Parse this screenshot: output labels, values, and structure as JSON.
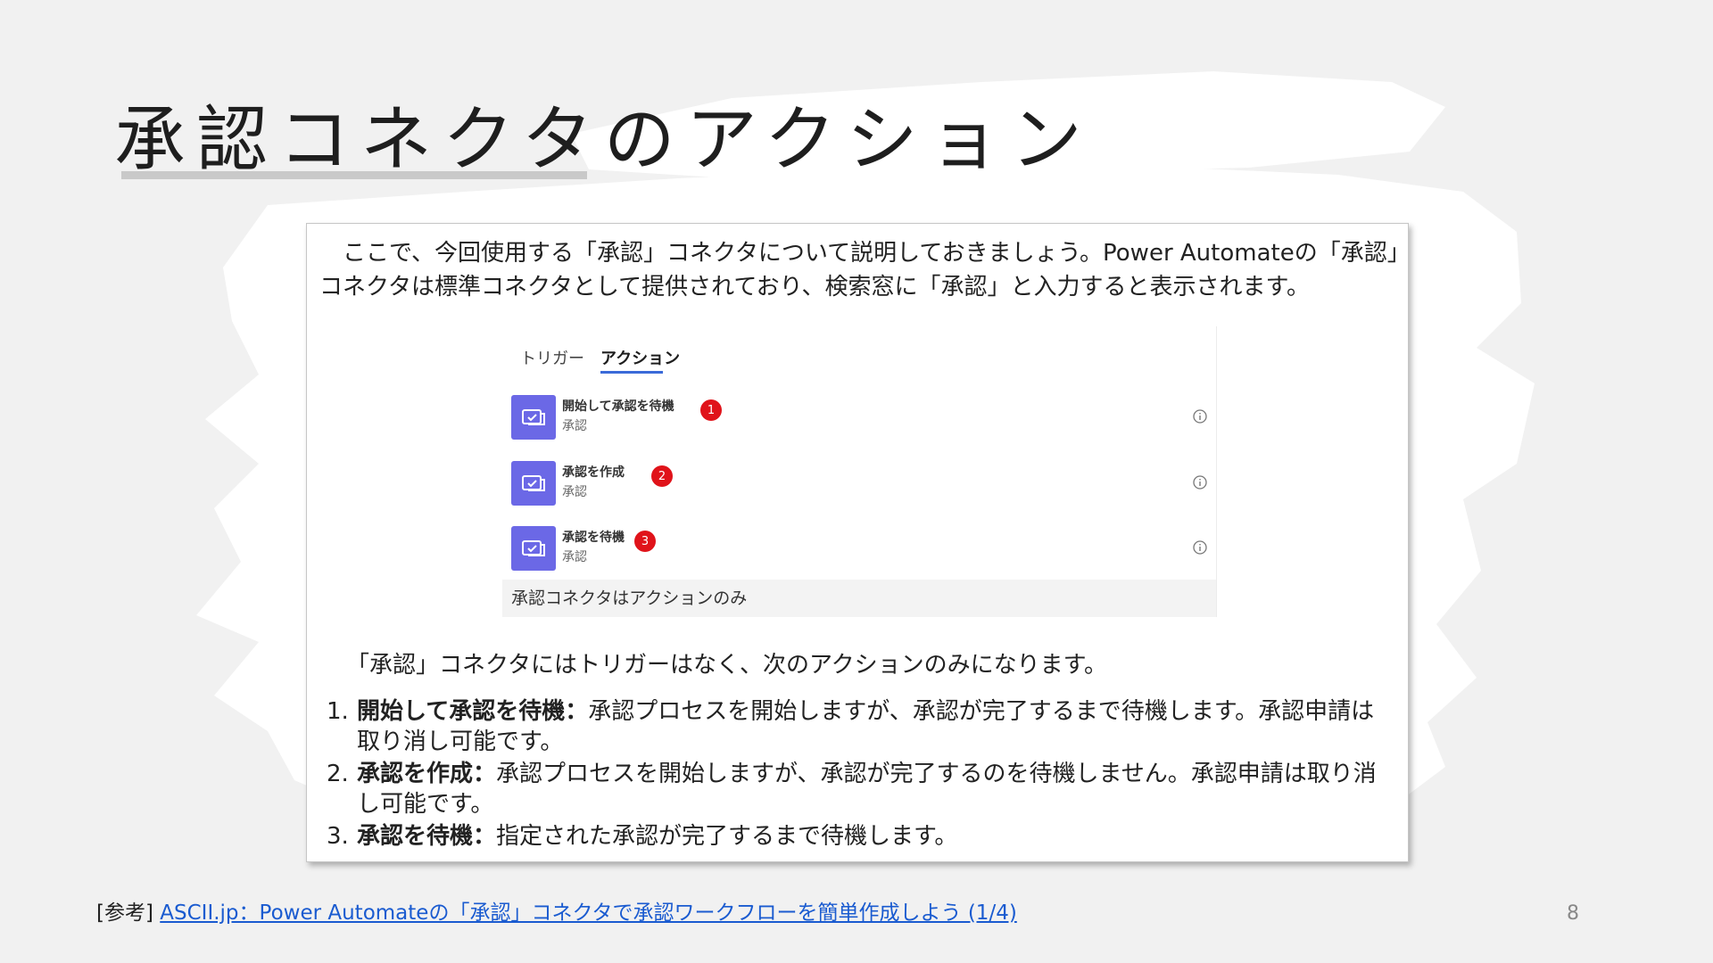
{
  "slide": {
    "title": "承認コネクタのアクション",
    "page_number": "8"
  },
  "card": {
    "intro": "ここで、今回使用する「承認」コネクタについて説明しておきましょう。Power Automateの「承認」コネクタは標準コネクタとして提供されており、検索窓に「承認」と入力すると表示されます。",
    "screenshot": {
      "tabs": [
        "トリガー",
        "アクション"
      ],
      "active_tab": "アクション",
      "actions": [
        {
          "name": "開始して承認を待機",
          "connector": "承認",
          "badge": "1",
          "icon": "approval-icon"
        },
        {
          "name": "承認を作成",
          "connector": "承認",
          "badge": "2",
          "icon": "approval-icon"
        },
        {
          "name": "承認を待機",
          "connector": "承認",
          "badge": "3",
          "icon": "approval-icon"
        }
      ],
      "caption": "承認コネクタはアクションのみ",
      "accent_color": "#6b68e6",
      "badge_color": "#e0131a"
    },
    "note": "「承認」コネクタにはトリガーはなく、次のアクションのみになります。",
    "list": [
      {
        "num": "1.",
        "term": "開始して承認を待機：",
        "desc": "承認プロセスを開始しますが、承認が完了するまで待機します。承認申請は取り消し可能です。"
      },
      {
        "num": "2.",
        "term": "承認を作成：",
        "desc": "承認プロセスを開始しますが、承認が完了するのを待機しません。承認申請は取り消し可能です。"
      },
      {
        "num": "3.",
        "term": "承認を待機：",
        "desc": "指定された承認が完了するまで待機します。"
      }
    ]
  },
  "footer": {
    "prefix": "[参考]",
    "link_text": "ASCII.jp：Power Automateの「承認」コネクタで承認ワークフローを簡単作成しよう (1/4)"
  }
}
